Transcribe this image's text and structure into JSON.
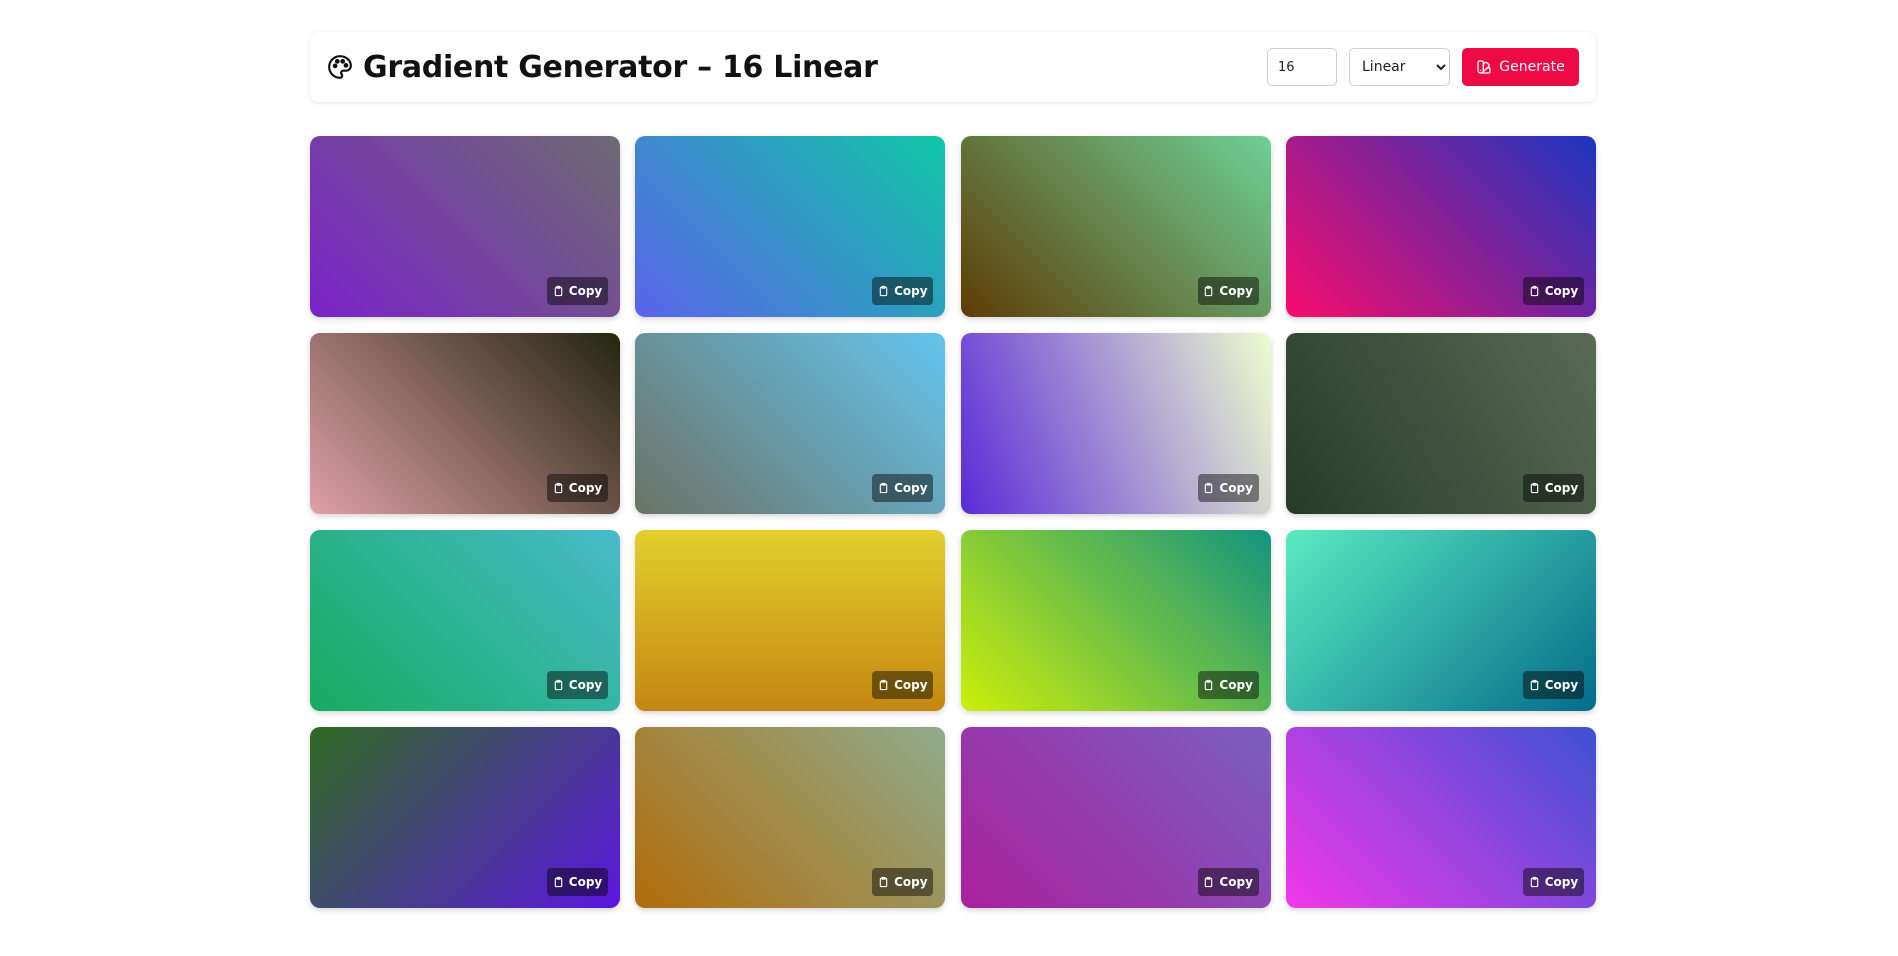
{
  "header": {
    "title": "Gradient Generator – 16 Linear",
    "icon": "palette-icon",
    "count_value": "16",
    "type_selected": "Linear",
    "type_options": [
      "Linear"
    ],
    "generate_label": "Generate",
    "generate_icon": "swatches-icon",
    "accent_color": "#ee0a44"
  },
  "cards": [
    {
      "label": "Copy",
      "angle": "45deg",
      "from": "#7b22c9",
      "to": "#6d6b72"
    },
    {
      "label": "Copy",
      "angle": "45deg",
      "from": "#5b63ea",
      "to": "#0fc6a5"
    },
    {
      "label": "Copy",
      "angle": "45deg",
      "from": "#5e3c06",
      "to": "#6dd196"
    },
    {
      "label": "Copy",
      "angle": "45deg",
      "from": "#f70c6c",
      "to": "#1b35bf"
    },
    {
      "label": "Copy",
      "angle": "45deg",
      "from": "#e0a0a8",
      "to": "#23260f"
    },
    {
      "label": "Copy",
      "angle": "45deg",
      "from": "#6b7365",
      "to": "#64c5ef"
    },
    {
      "label": "Copy",
      "angle": "70deg",
      "from": "#5a2ad8",
      "to": "#eefccf"
    },
    {
      "label": "Copy",
      "angle": "60deg",
      "from": "#283b2b",
      "to": "#5a6a55"
    },
    {
      "label": "Copy",
      "angle": "45deg",
      "from": "#16ab60",
      "to": "#48bbca"
    },
    {
      "label": "Copy",
      "angle": "0deg",
      "from": "#c48711",
      "to": "#e2cf2c"
    },
    {
      "label": "Copy",
      "angle": "45deg",
      "from": "#cdee0a",
      "to": "#129480"
    },
    {
      "label": "Copy",
      "angle": "135deg",
      "from": "#5aebc0",
      "to": "#046c8b"
    },
    {
      "label": "Copy",
      "angle": "135deg",
      "from": "#2f6b22",
      "to": "#5b17e0"
    },
    {
      "label": "Copy",
      "angle": "45deg",
      "from": "#b06d0a",
      "to": "#90ab8c"
    },
    {
      "label": "Copy",
      "angle": "45deg",
      "from": "#aa20a0",
      "to": "#7a5fc0"
    },
    {
      "label": "Copy",
      "angle": "45deg",
      "from": "#f237ea",
      "to": "#3d52d2"
    }
  ]
}
